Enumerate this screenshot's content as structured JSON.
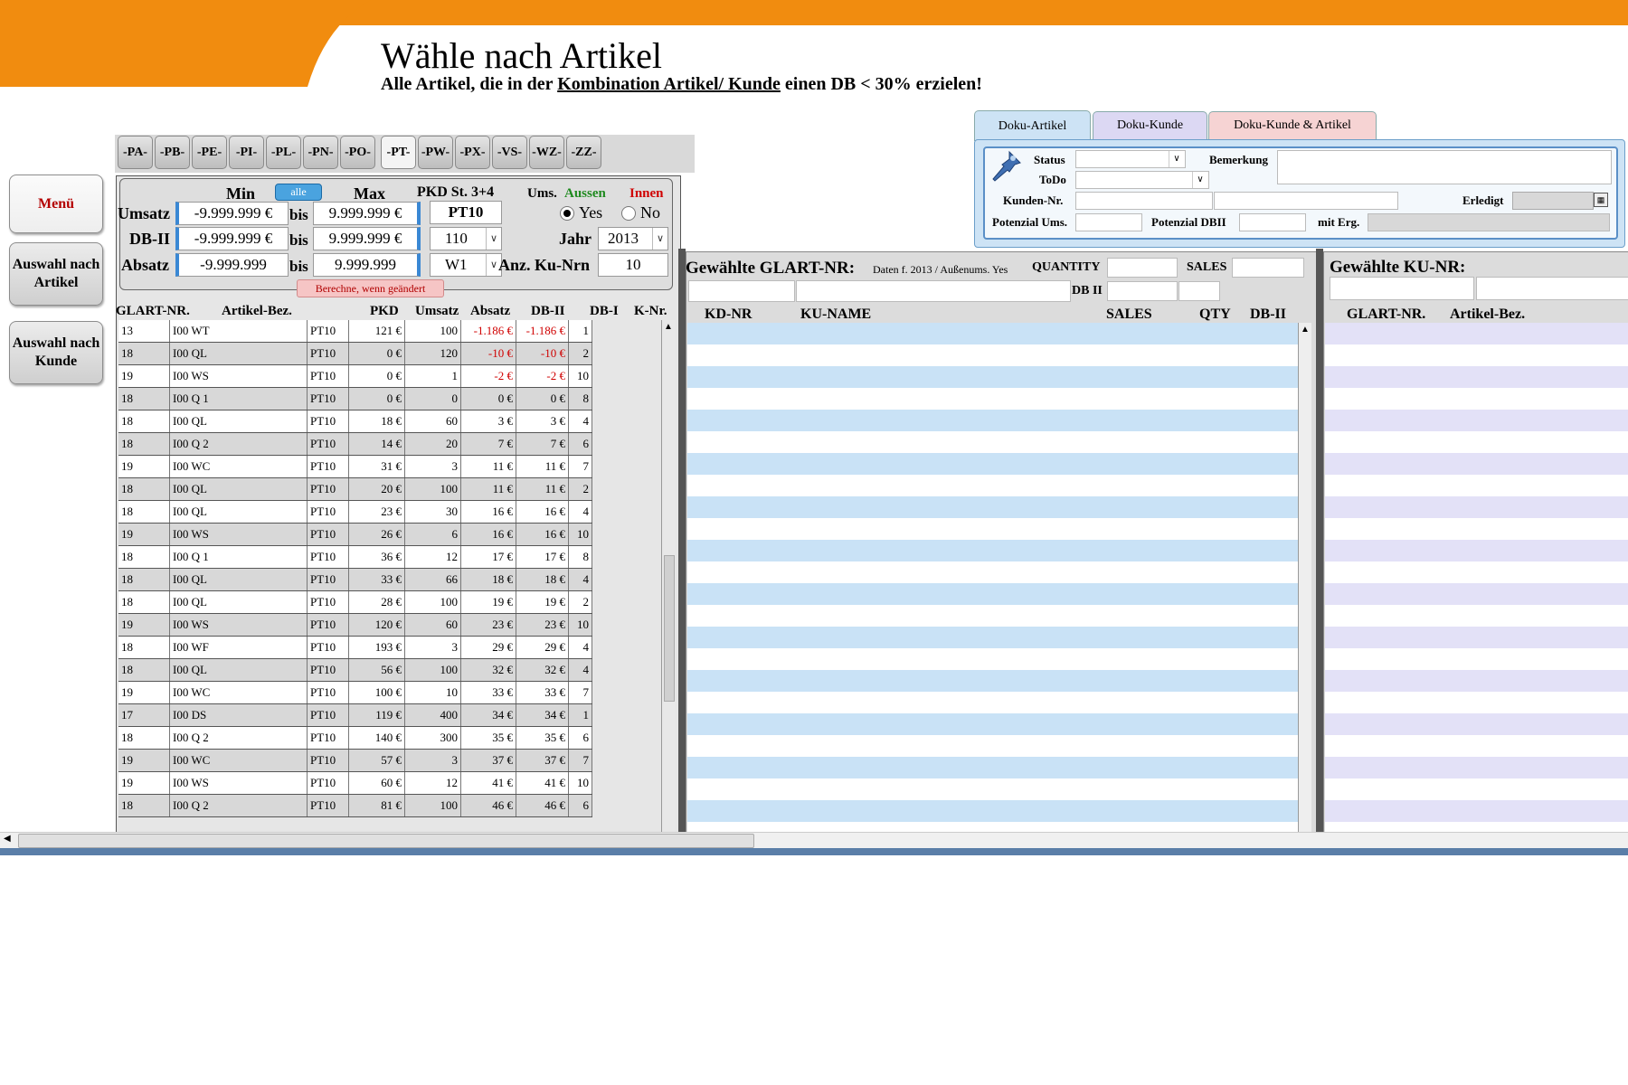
{
  "header": {
    "title": "Wähle nach Artikel",
    "subtitle_pre": "Alle Artikel, die in der ",
    "subtitle_link": "Kombination Artikel/ Kunde",
    "subtitle_post": " einen DB < 30% erzielen!"
  },
  "nav": {
    "menu": "Menü",
    "by_article": "Auswahl nach Artikel",
    "by_customer": "Auswahl nach Kunde"
  },
  "categories": [
    "-PA-",
    "-PB-",
    "-PE-",
    "-PI-",
    "-PL-",
    "-PN-",
    "-PO-",
    "-PT-",
    "-PW-",
    "-PX-",
    "-VS-",
    "-WZ-",
    "-ZZ-"
  ],
  "active_category": "-PT-",
  "filter": {
    "min_label": "Min",
    "alle": "alle",
    "max_label": "Max",
    "pkd_label": "PKD St. 3+4",
    "ums_label": "Ums.",
    "aussen": "Aussen",
    "innen": "Innen",
    "umsatz_label": "Umsatz",
    "umsatz_min": "-9.999.999 €",
    "umsatz_max": "9.999.999 €",
    "dbii_label": "DB-II",
    "dbii_min": "-9.999.999 €",
    "dbii_max": "9.999.999 €",
    "absatz_label": "Absatz",
    "absatz_min": "-9.999.999",
    "absatz_max": "9.999.999",
    "bis": "bis",
    "pkd_value": "PT10",
    "select_110": "110",
    "select_w1": "W1",
    "yes": "Yes",
    "no": "No",
    "jahr_label": "Jahr",
    "jahr_value": "2013",
    "anz_label": "Anz. Ku-Nrn",
    "anz_value": "10",
    "berechne": "Berechne, wenn geändert"
  },
  "table": {
    "headers": [
      "GLART-NR.",
      "Artikel-Bez.",
      "PKD",
      "Umsatz",
      "Absatz",
      "DB-II",
      "DB-I",
      "K-Nr."
    ],
    "rows": [
      [
        "13",
        "I00 WT",
        "PT10",
        "121 €",
        "100",
        "-1.186 €",
        "-1.186 €",
        "1"
      ],
      [
        "18",
        "I00 QL",
        "PT10",
        "0 €",
        "120",
        "-10 €",
        "-10 €",
        "2"
      ],
      [
        "19",
        "I00 WS",
        "PT10",
        "0 €",
        "1",
        "-2 €",
        "-2 €",
        "10"
      ],
      [
        "18",
        "I00 Q 1",
        "PT10",
        "0 €",
        "0",
        "0 €",
        "0 €",
        "8"
      ],
      [
        "18",
        "I00 QL",
        "PT10",
        "18 €",
        "60",
        "3 €",
        "3 €",
        "4"
      ],
      [
        "18",
        "I00 Q 2",
        "PT10",
        "14 €",
        "20",
        "7 €",
        "7 €",
        "6"
      ],
      [
        "19",
        "I00 WC",
        "PT10",
        "31 €",
        "3",
        "11 €",
        "11 €",
        "7"
      ],
      [
        "18",
        "I00 QL",
        "PT10",
        "20 €",
        "100",
        "11 €",
        "11 €",
        "2"
      ],
      [
        "18",
        "I00 QL",
        "PT10",
        "23 €",
        "30",
        "16 €",
        "16 €",
        "4"
      ],
      [
        "19",
        "I00 WS",
        "PT10",
        "26 €",
        "6",
        "16 €",
        "16 €",
        "10"
      ],
      [
        "18",
        "I00 Q 1",
        "PT10",
        "36 €",
        "12",
        "17 €",
        "17 €",
        "8"
      ],
      [
        "18",
        "I00 QL",
        "PT10",
        "33 €",
        "66",
        "18 €",
        "18 €",
        "4"
      ],
      [
        "18",
        "I00 QL",
        "PT10",
        "28 €",
        "100",
        "19 €",
        "19 €",
        "2"
      ],
      [
        "19",
        "I00 WS",
        "PT10",
        "120 €",
        "60",
        "23 €",
        "23 €",
        "10"
      ],
      [
        "18",
        "I00 WF",
        "PT10",
        "193 €",
        "3",
        "29 €",
        "29 €",
        "4"
      ],
      [
        "18",
        "I00 QL",
        "PT10",
        "56 €",
        "100",
        "32 €",
        "32 €",
        "4"
      ],
      [
        "19",
        "I00 WC",
        "PT10",
        "100 €",
        "10",
        "33 €",
        "33 €",
        "7"
      ],
      [
        "17",
        "I00 DS",
        "PT10",
        "119 €",
        "400",
        "34 €",
        "34 €",
        "1"
      ],
      [
        "18",
        "I00 Q 2",
        "PT10",
        "140 €",
        "300",
        "35 €",
        "35 €",
        "6"
      ],
      [
        "19",
        "I00 WC",
        "PT10",
        "57 €",
        "3",
        "37 €",
        "37 €",
        "7"
      ],
      [
        "19",
        "I00 WS",
        "PT10",
        "60 €",
        "12",
        "41 €",
        "41 €",
        "10"
      ],
      [
        "18",
        "I00 Q 2",
        "PT10",
        "81 €",
        "100",
        "46 €",
        "46 €",
        "6"
      ]
    ]
  },
  "middle": {
    "title": "Gewählte GLART-NR:",
    "info": "Daten f. 2013 / Außenums. Yes",
    "quantity": "QUANTITY",
    "sales": "SALES",
    "dbii": "DB II",
    "headers": [
      "KD-NR",
      "KU-NAME",
      "SALES",
      "QTY",
      "DB-II"
    ]
  },
  "right": {
    "title": "Gewählte KU-NR:",
    "headers": [
      "GLART-NR.",
      "Artikel-Bez."
    ]
  },
  "doku": {
    "tabs": [
      "Doku-Artikel",
      "Doku-Kunde",
      "Doku-Kunde & Artikel"
    ],
    "status": "Status",
    "bemerkung": "Bemerkung",
    "todo": "ToDo",
    "kunden_nr": "Kunden-Nr.",
    "erledigt": "Erledigt",
    "pot_ums": "Potenzial Ums.",
    "pot_dbii": "Potenzial DBII",
    "mit_erg": "mit Erg."
  },
  "colors": {
    "orange": "#f18c0f",
    "aussen": "#1f8a1f",
    "innen": "#d00000",
    "negative": "#d00000",
    "list_blue": "#c9e2f6",
    "list_lavender": "#e3e1f7"
  }
}
